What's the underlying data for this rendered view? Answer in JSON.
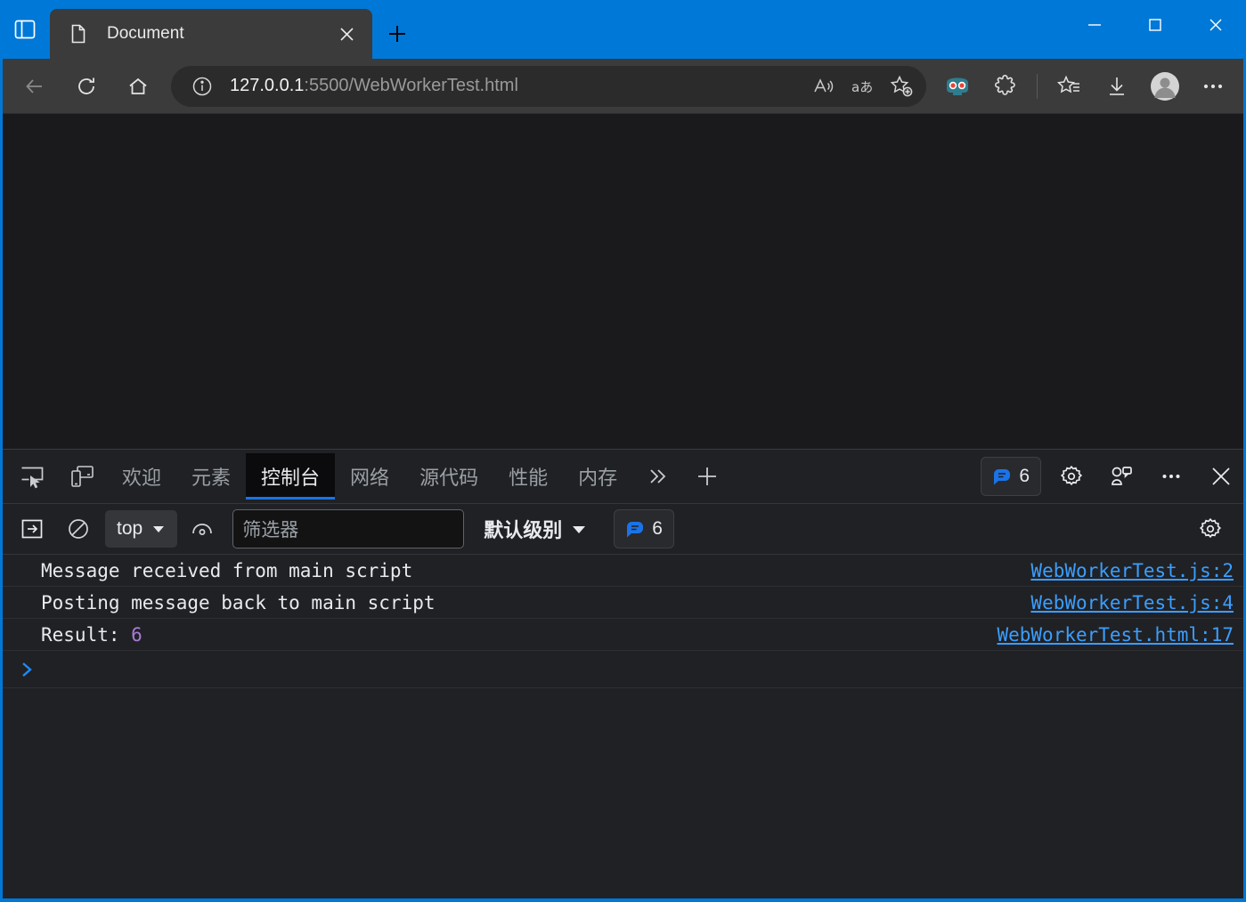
{
  "window": {
    "title_bar_color": "#0078d7",
    "controls": {
      "minimize": "minimize-button",
      "maximize": "maximize-button",
      "close": "close-button"
    }
  },
  "browser": {
    "tab_sidebar_label": "tab-actions",
    "tabs": [
      {
        "title": "Document",
        "favicon": "document-icon",
        "active": true
      }
    ],
    "new_tab_label": "新建标签页",
    "nav": {
      "back": "back-button",
      "refresh": "refresh-button",
      "home": "home-button"
    },
    "omnibox": {
      "host": "127.0.0.1",
      "path": ":5500/WebWorkerTest.html",
      "full_url": "127.0.0.1:5500/WebWorkerTest.html",
      "info_icon": "site-information-icon",
      "actions": [
        "read-aloud-icon",
        "translate-icon",
        "add-favorite-icon"
      ]
    },
    "toolbar_icons": [
      "browser-essentials-icon",
      "extensions-icon",
      "collections-icon",
      "downloads-icon",
      "profile-icon",
      "settings-and-more-icon"
    ]
  },
  "devtools": {
    "left_icons": [
      "inspect-element-icon",
      "device-emulation-icon"
    ],
    "tabs": [
      {
        "label": "欢迎",
        "active": false
      },
      {
        "label": "元素",
        "active": false
      },
      {
        "label": "控制台",
        "active": true
      },
      {
        "label": "网络",
        "active": false
      },
      {
        "label": "源代码",
        "active": false
      },
      {
        "label": "性能",
        "active": false
      },
      {
        "label": "内存",
        "active": false
      }
    ],
    "more_tabs_label": "更多工具",
    "add_panel_label": "添加面板",
    "issues_badge": {
      "icon": "message-bubble-icon",
      "count": "6"
    },
    "right_icons": [
      "settings-gear-icon",
      "customize-devtools-icon",
      "more-options-icon",
      "close-devtools-icon"
    ],
    "filterbar": {
      "sidebar_toggle": "console-sidebar-icon",
      "clear_console": "clear-console-icon",
      "context": "top",
      "context_caret": "chevron-down-icon",
      "live_expression": "eye-icon",
      "filter_placeholder": "筛选器",
      "filter_value": "",
      "level": "默认级别",
      "level_caret": "chevron-down-icon",
      "message_badge": {
        "icon": "message-bubble-icon",
        "count": "6"
      },
      "settings": "settings-gear-icon"
    },
    "console_logs": [
      {
        "message": "Message received from main script",
        "value": "",
        "source": "WebWorkerTest.js:2"
      },
      {
        "message": "Posting message back to main script",
        "value": "",
        "source": "WebWorkerTest.js:4"
      },
      {
        "message": "Result: ",
        "value": "6",
        "source": "WebWorkerTest.html:17"
      }
    ],
    "prompt_icon": "console-prompt-chevron-icon",
    "prompt_value": ""
  },
  "colors": {
    "accent_blue": "#0078d7",
    "devtools_bg": "#202124",
    "page_bg": "#1a1a1c",
    "link_blue": "#3b9eff",
    "number_purple": "#a97bd6",
    "active_tab_underline": "#1a73e8"
  }
}
